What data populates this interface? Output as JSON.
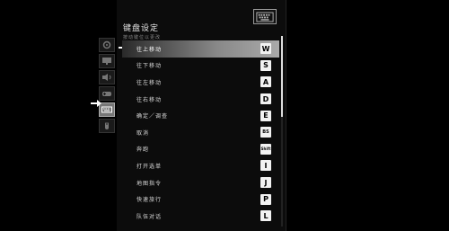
{
  "header": {
    "title": "键盘设定",
    "subtitle": "按动键位以更改"
  },
  "sidebar": {
    "items": [
      {
        "name": "gear",
        "active": false
      },
      {
        "name": "monitor",
        "active": false
      },
      {
        "name": "speaker",
        "active": false
      },
      {
        "name": "gamepad",
        "active": false
      },
      {
        "name": "keyboard",
        "active": true
      },
      {
        "name": "mouse",
        "active": false
      }
    ]
  },
  "bindings": [
    {
      "label": "往上移动",
      "key": "W"
    },
    {
      "label": "往下移动",
      "key": "S"
    },
    {
      "label": "往左移动",
      "key": "A"
    },
    {
      "label": "往右移动",
      "key": "D"
    },
    {
      "label": "确定／调查",
      "key": "E"
    },
    {
      "label": "取消",
      "key": "BS"
    },
    {
      "label": "奔跑",
      "key": "Shift"
    },
    {
      "label": "打开选单",
      "key": "I"
    },
    {
      "label": "地图指令",
      "key": "J"
    },
    {
      "label": "快速旅行",
      "key": "P"
    },
    {
      "label": "队伍对话",
      "key": "L"
    }
  ],
  "colors": {
    "selected_row": "#aaaaaa",
    "key_bg": "#f2f2f2"
  }
}
